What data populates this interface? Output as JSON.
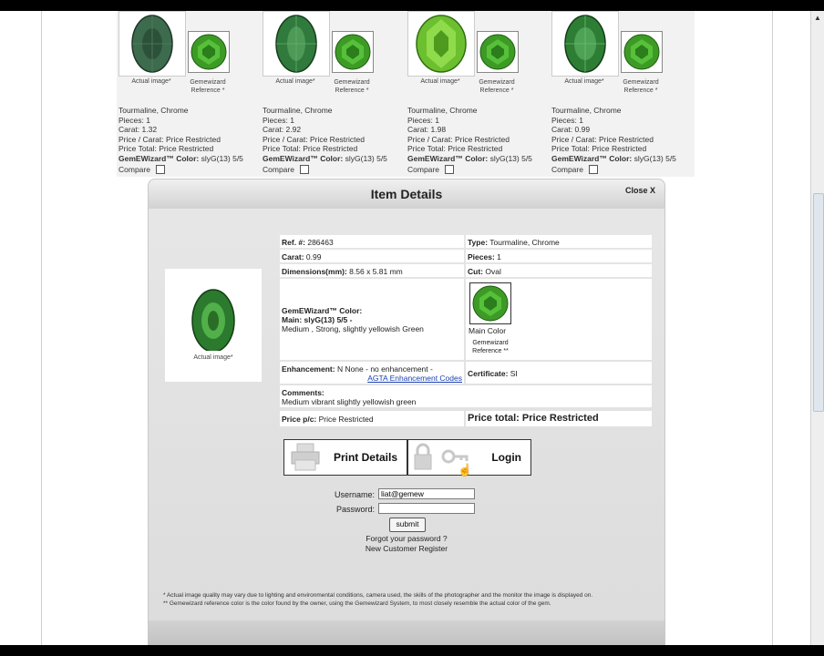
{
  "results": [
    {
      "actual_caption": "Actual image*",
      "ref_caption_1": "Gemewizard",
      "ref_caption_2": "Reference *",
      "type": "Tourmaline, Chrome",
      "pieces": "Pieces: 1",
      "carat": "Carat: 1.32",
      "price_carat": "Price / Carat: Price Restricted",
      "price_total": "Price Total: Price Restricted",
      "color_label": "GemEWizard™ Color:",
      "color_value": " slyG(13) 5/5",
      "compare": "Compare",
      "gem_color": "#3d6b4d"
    },
    {
      "actual_caption": "Actual image*",
      "ref_caption_1": "Gemewizard",
      "ref_caption_2": "Reference *",
      "type": "Tourmaline, Chrome",
      "pieces": "Pieces: 1",
      "carat": "Carat: 2.92",
      "price_carat": "Price / Carat: Price Restricted",
      "price_total": "Price Total: Price Restricted",
      "color_label": "GemEWizard™ Color:",
      "color_value": " slyG(13) 5/5",
      "compare": "Compare",
      "gem_color": "#2f7a3c"
    },
    {
      "actual_caption": "Actual image*",
      "ref_caption_1": "Gemewizard",
      "ref_caption_2": "Reference *",
      "type": "Tourmaline, Chrome",
      "pieces": "Pieces: 1",
      "carat": "Carat: 1.98",
      "price_carat": "Price / Carat: Price Restricted",
      "price_total": "Price Total: Price Restricted",
      "color_label": "GemEWizard™ Color:",
      "color_value": " slyG(13) 5/5",
      "compare": "Compare",
      "gem_color": "#6cbf2f"
    },
    {
      "actual_caption": "Actual image*",
      "ref_caption_1": "Gemewizard",
      "ref_caption_2": "Reference *",
      "type": "Tourmaline, Chrome",
      "pieces": "Pieces: 1",
      "carat": "Carat: 0.99",
      "price_carat": "Price / Carat: Price Restricted",
      "price_total": "Price Total: Price Restricted",
      "color_label": "GemEWizard™ Color:",
      "color_value": " slyG(13) 5/5",
      "compare": "Compare",
      "gem_color": "#2e7d35"
    }
  ],
  "modal": {
    "title": "Item Details",
    "close": "Close X",
    "actual_caption": "Actual image*",
    "ref_label": "Ref. #:",
    "ref_value": " 286463",
    "type_label": "Type:",
    "type_value": " Tourmaline, Chrome",
    "carat_label": "Carat:",
    "carat_value": " 0.99",
    "pieces_label": "Pieces:",
    "pieces_value": " 1",
    "dim_label": "Dimensions(mm):",
    "dim_value": " 8.56 x 5.81 mm",
    "cut_label": "Cut:",
    "cut_value": " Oval",
    "color_heading": "GemEWizard™ Color:",
    "main_label": "Main: slyG(13) 5/5 -",
    "main_desc": "Medium , Strong, slightly yellowish Green",
    "main_color_caption": "Main Color",
    "gw_ref_1": "Gemewizard",
    "gw_ref_2": "Reference **",
    "enh_label": "Enhancement:",
    "enh_value": " N None - no enhancement -",
    "enh_link": "AGTA Enhancement Codes",
    "cert_label": "Certificate:",
    "cert_value": " SI",
    "comments_label": "Comments:",
    "comments_value": "Medium vibrant slightly yellowish green",
    "price_pc_label": "Price p/c:",
    "price_pc_value": " Price Restricted",
    "price_total": "Price total: Price Restricted",
    "print_label": "Print Details",
    "login_label": "Login",
    "username_label": "Username:",
    "username_value": "liat@gemew",
    "password_label": "Password:",
    "password_value": "",
    "submit_label": "submit",
    "forgot": "Forgot your password ?",
    "register": "New Customer Register",
    "footnote_1": "* Actual image quality may vary due to lighting and environmental conditions, camera used, the skills of the photographer and the monitor the image is displayed on.",
    "footnote_2": "** Gemewizard reference color is the color found by the owner, using the Gemewizard System, to most closely resemble the actual color of the gem."
  }
}
